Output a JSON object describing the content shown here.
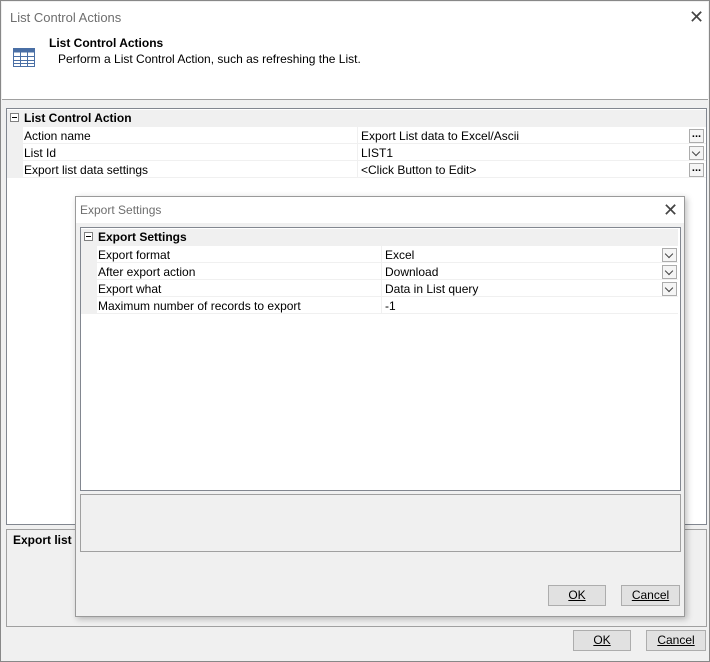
{
  "window": {
    "title": "List Control Actions",
    "header_title": "List Control Actions",
    "header_subtitle": "Perform a List Control Action, such as refreshing the List.",
    "header_icon": "table-icon",
    "close_icon": "close-icon"
  },
  "main_grid": {
    "category": "List Control Action",
    "rows": [
      {
        "name": "Action name",
        "value": "Export List data to Excel/Ascii",
        "editor": "ellipsis"
      },
      {
        "name": "List Id",
        "value": "LIST1",
        "editor": "dropdown"
      },
      {
        "name": "Export list data settings",
        "value": "<Click Button to Edit>",
        "editor": "ellipsis"
      }
    ],
    "ellipsis_label": "..."
  },
  "main_desc": {
    "label": "Export list d"
  },
  "main_buttons": {
    "ok": "OK",
    "cancel": "Cancel"
  },
  "dialog": {
    "title": "Export Settings",
    "close_icon": "close-icon",
    "category": "Export Settings",
    "rows": [
      {
        "name": "Export format",
        "value": "Excel",
        "editor": "dropdown"
      },
      {
        "name": "After export action",
        "value": "Download",
        "editor": "dropdown"
      },
      {
        "name": "Export what",
        "value": "Data in List query",
        "editor": "dropdown"
      },
      {
        "name": "Maximum number of records to export",
        "value": "-1",
        "editor": "none"
      }
    ],
    "buttons": {
      "ok": "OK",
      "cancel": "Cancel"
    }
  }
}
